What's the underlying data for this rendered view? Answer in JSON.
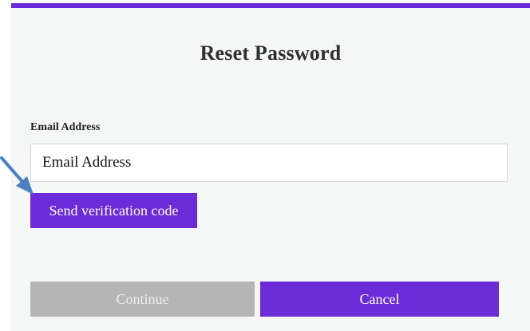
{
  "header": {
    "title": "Reset Password",
    "accent_color": "#6c2bd9"
  },
  "form": {
    "email_label": "Email Address",
    "email_placeholder": "Email Address",
    "email_value": "",
    "send_code_label": "Send verification code"
  },
  "actions": {
    "continue_label": "Continue",
    "continue_disabled": true,
    "cancel_label": "Cancel"
  },
  "annotation": {
    "icon": "arrow-pointer-icon",
    "color": "#4a7fc1"
  }
}
